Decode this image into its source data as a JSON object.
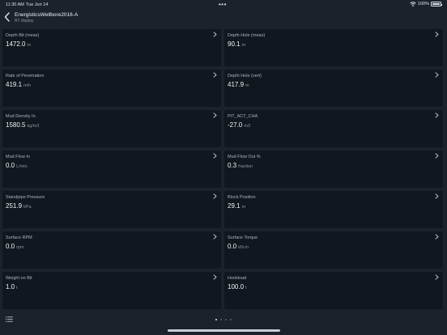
{
  "statusbar": {
    "time": "11:30 AM",
    "date": "Tue Jun 14",
    "battery": "100%"
  },
  "nav": {
    "title": "EnergisticsWellbore2016-A",
    "subtitle": "RT display"
  },
  "tiles": [
    {
      "title": "Depth Bit (meas)",
      "value": "1472.0",
      "unit": "m"
    },
    {
      "title": "Depth Hole (meas)",
      "value": "90.1",
      "unit": "m"
    },
    {
      "title": "Rate of Penetration",
      "value": "419.1",
      "unit": "m/h"
    },
    {
      "title": "Depth Hole (vert)",
      "value": "417.9",
      "unit": "m"
    },
    {
      "title": "Mud Density In",
      "value": "1580.5",
      "unit": "kg/m3"
    },
    {
      "title": "PIT_ACT_CHA",
      "value": "-27.0",
      "unit": "m3"
    },
    {
      "title": "Mud Flow In",
      "value": "0.0",
      "unit": "L/min"
    },
    {
      "title": "Mud Flow Out %",
      "value": "0.3",
      "unit": "fraction"
    },
    {
      "title": "Standpipe Pressure",
      "value": "251.9",
      "unit": "kPa"
    },
    {
      "title": "Block Position",
      "value": "29.1",
      "unit": "m"
    },
    {
      "title": "Surface RPM",
      "value": "0.0",
      "unit": "rpm"
    },
    {
      "title": "Surface Torque",
      "value": "0.0",
      "unit": "kN.m"
    },
    {
      "title": "Weight on Bit",
      "value": "1.0",
      "unit": "t"
    },
    {
      "title": "Hookload",
      "value": "100.0",
      "unit": "t"
    }
  ],
  "pager": {
    "pages": 4,
    "active": 0
  }
}
